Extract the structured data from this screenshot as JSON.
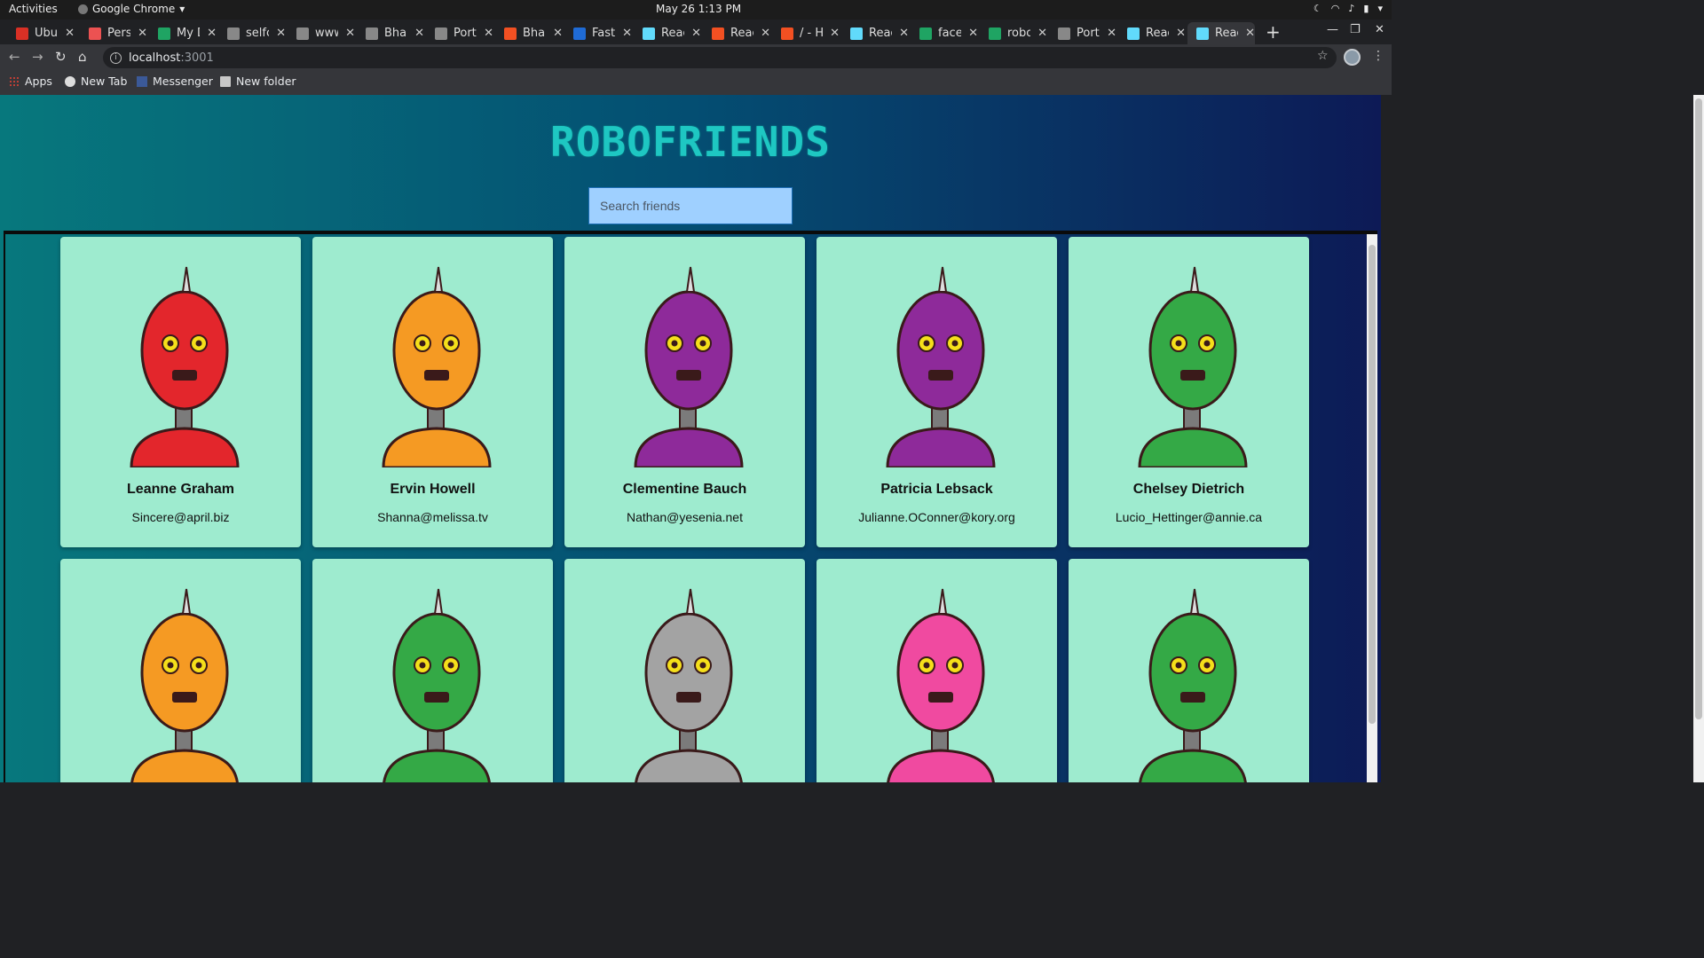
{
  "system": {
    "activities": "Activities",
    "app_name": "Google Chrome",
    "clock": "May 26  1:13 PM"
  },
  "tabs": [
    {
      "title": "Ubuntu",
      "icon": "gmail-icon",
      "color": "#d93025"
    },
    {
      "title": "Pers",
      "icon": "udemy-icon",
      "color": "#ec5252"
    },
    {
      "title": "My D",
      "icon": "drive-icon",
      "color": "#1fa463"
    },
    {
      "title": "selfc",
      "icon": "a-icon",
      "color": "#888888"
    },
    {
      "title": "www",
      "icon": "dropbox-icon",
      "color": "#888888"
    },
    {
      "title": "Bhar",
      "icon": "globe-icon",
      "color": "#888888"
    },
    {
      "title": "Port",
      "icon": "globe-icon",
      "color": "#888888"
    },
    {
      "title": "Bhar",
      "icon": "f-icon",
      "color": "#f25022"
    },
    {
      "title": "Fast",
      "icon": "f-icon",
      "color": "#1f6bd6"
    },
    {
      "title": "Reac",
      "icon": "react-icon",
      "color": "#61dafb"
    },
    {
      "title": "Reac",
      "icon": "f-icon",
      "color": "#f25022"
    },
    {
      "title": "/ - H",
      "icon": "f-icon",
      "color": "#f25022"
    },
    {
      "title": "Reac",
      "icon": "react-icon",
      "color": "#61dafb"
    },
    {
      "title": "face",
      "icon": "drive-icon",
      "color": "#1fa463"
    },
    {
      "title": "robo",
      "icon": "drive-icon",
      "color": "#1fa463"
    },
    {
      "title": "Port",
      "icon": "globe-icon",
      "color": "#888888"
    },
    {
      "title": "Reac",
      "icon": "react-icon",
      "color": "#61dafb"
    },
    {
      "title": "Reac",
      "icon": "react-icon",
      "color": "#61dafb"
    }
  ],
  "address": {
    "host": "localhost",
    "port": ":3001"
  },
  "bookmarks": [
    {
      "label": "Apps",
      "icon": "apps-grid-icon"
    },
    {
      "label": "New Tab",
      "icon": "globe-icon"
    },
    {
      "label": "Messenger",
      "icon": "facebook-icon"
    },
    {
      "label": "New folder",
      "icon": "folder-icon"
    }
  ],
  "app": {
    "title": "ROBOFRIENDS",
    "search_placeholder": "Search friends",
    "colors": {
      "card": "#9eebcf",
      "title": "#1ec7c2",
      "search_bg": "#9fd0ff"
    }
  },
  "robots": [
    {
      "name": "Leanne Graham",
      "email": "Sincere@april.biz",
      "color": "#e3262c"
    },
    {
      "name": "Ervin Howell",
      "email": "Shanna@melissa.tv",
      "color": "#f59a23"
    },
    {
      "name": "Clementine Bauch",
      "email": "Nathan@yesenia.net",
      "color": "#8e2a9a"
    },
    {
      "name": "Patricia Lebsack",
      "email": "Julianne.OConner@kory.org",
      "color": "#8e2a9a"
    },
    {
      "name": "Chelsey Dietrich",
      "email": "Lucio_Hettinger@annie.ca",
      "color": "#34a946"
    },
    {
      "name": "",
      "email": "",
      "color": "#f59a23"
    },
    {
      "name": "",
      "email": "",
      "color": "#34a946"
    },
    {
      "name": "",
      "email": "",
      "color": "#a3a3a3"
    },
    {
      "name": "",
      "email": "",
      "color": "#f04aa0"
    },
    {
      "name": "",
      "email": "",
      "color": "#34a946"
    }
  ]
}
